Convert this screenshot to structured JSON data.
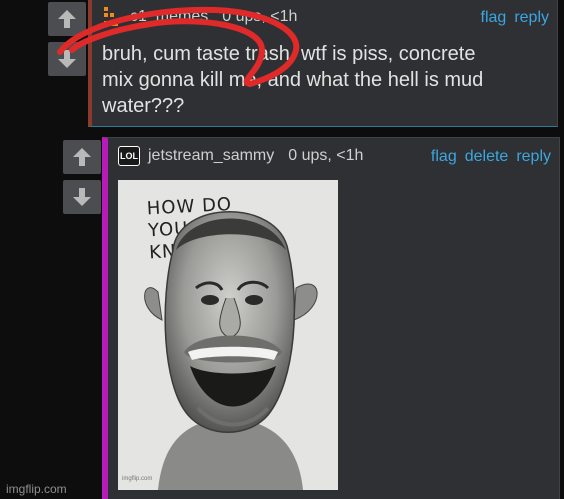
{
  "comment1": {
    "username": "c1_memes",
    "meta": "0 ups, <1h",
    "links": [
      "flag",
      "reply"
    ],
    "text_lines": [
      "bruh, cum taste trash, wtf is piss, concrete",
      "mix gonna kill me, and what the hell is mud",
      "water???"
    ],
    "border_color": "#8a3b2e",
    "annotation_color": "#e02a2a"
  },
  "comment2": {
    "badge": "LOL",
    "username": "jetstream_sammy",
    "meta": "0 ups, <1h",
    "links": [
      "flag",
      "delete",
      "reply"
    ],
    "border_color": "#b81cb8",
    "image": {
      "caption": "HOW DO YOU KNOW!!!",
      "watermark": "imgflip.com"
    }
  },
  "footer": {
    "watermark": "imgflip.com"
  }
}
